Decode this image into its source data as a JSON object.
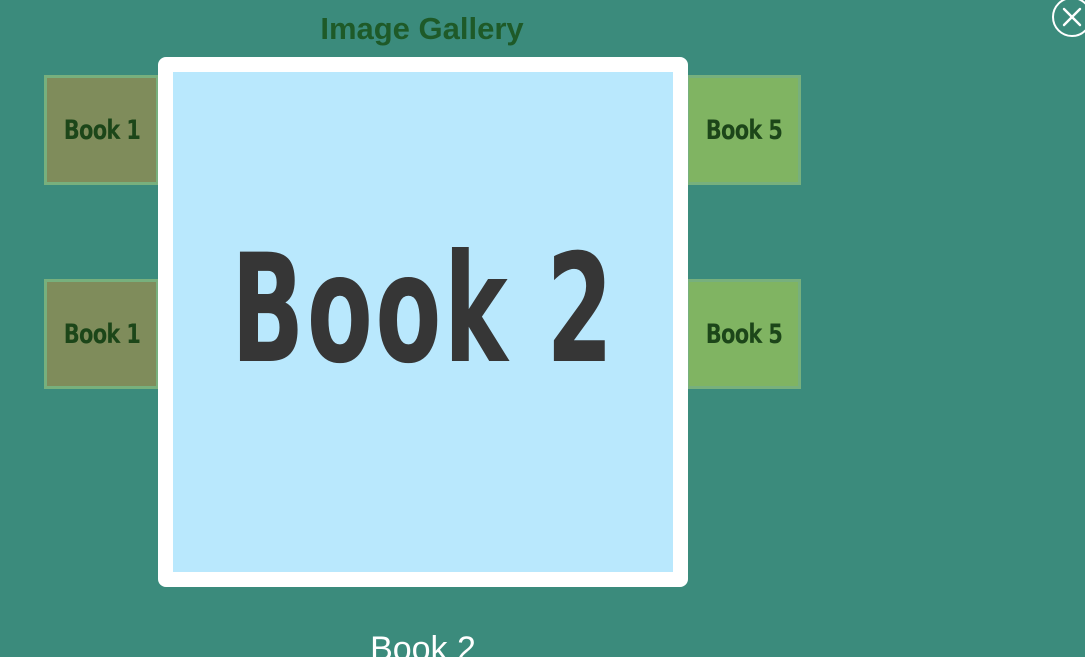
{
  "gallery": {
    "title": "Image Gallery",
    "thumbnails": [
      {
        "label": "Book 1",
        "color": "#7f8c5b"
      },
      {
        "label": "Book 5",
        "color": "#80b462"
      },
      {
        "label": "Book 1",
        "color": "#7f8c5b"
      },
      {
        "label": "Book 5",
        "color": "#80b462"
      }
    ]
  },
  "lightbox": {
    "image_text": "Book 2",
    "caption": "Book 2",
    "close_icon": "close-icon"
  },
  "colors": {
    "page_background": "#3b8b7c",
    "title_color": "#1e5a28",
    "image_background": "#b9e8fd"
  }
}
